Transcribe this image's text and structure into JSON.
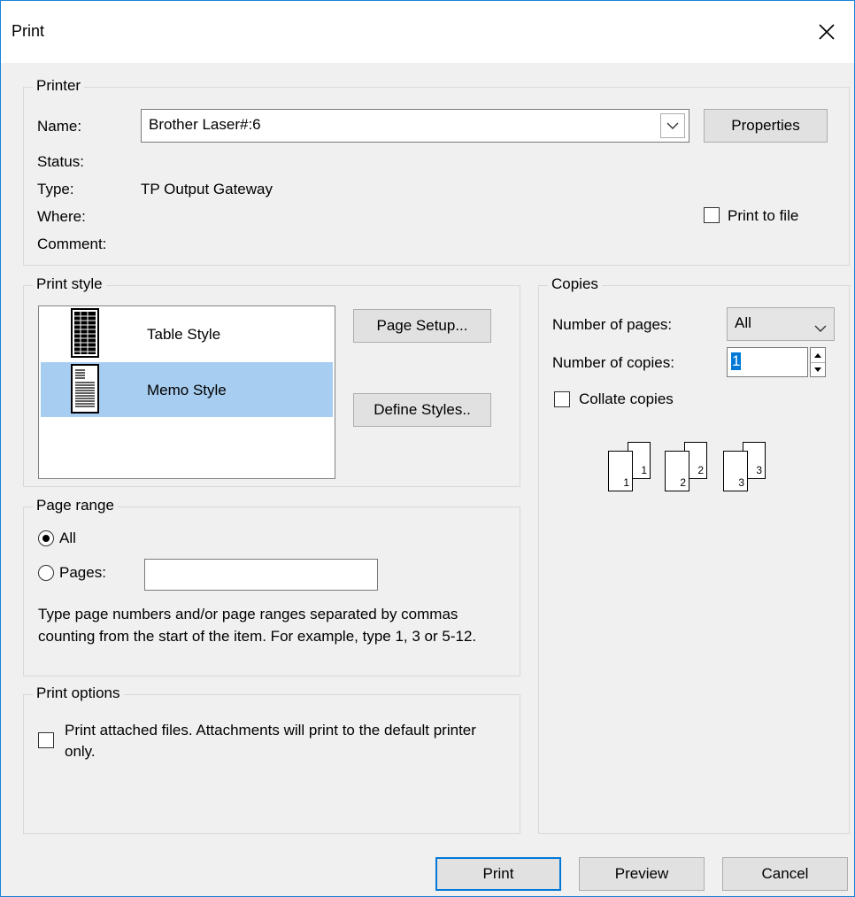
{
  "window": {
    "title": "Print"
  },
  "printer": {
    "group_label": "Printer",
    "name_label": "Name:",
    "name_value": "Brother Laser#:6",
    "properties_button": "Properties",
    "status_label": "Status:",
    "status_value": "",
    "type_label": "Type:",
    "type_value": "TP Output Gateway",
    "where_label": "Where:",
    "where_value": "",
    "comment_label": "Comment:",
    "comment_value": "",
    "print_to_file_label": "Print to file",
    "print_to_file_checked": false
  },
  "print_style": {
    "group_label": "Print style",
    "items": [
      {
        "label": "Table Style",
        "icon": "table-style-icon",
        "selected": false
      },
      {
        "label": "Memo Style",
        "icon": "memo-style-icon",
        "selected": true
      }
    ],
    "page_setup_button": "Page Setup...",
    "define_styles_button": "Define Styles.."
  },
  "copies": {
    "group_label": "Copies",
    "number_of_pages_label": "Number of pages:",
    "number_of_pages_value": "All",
    "number_of_copies_label": "Number of copies:",
    "number_of_copies_value": "1",
    "collate_label": "Collate copies",
    "collate_checked": false,
    "collate_pages": [
      {
        "back": "1",
        "front": "1"
      },
      {
        "back": "2",
        "front": "2"
      },
      {
        "back": "3",
        "front": "3"
      }
    ]
  },
  "page_range": {
    "group_label": "Page range",
    "all_label": "All",
    "all_selected": true,
    "pages_label": "Pages:",
    "pages_value": "",
    "description": "Type page numbers and/or page ranges separated by commas counting from the start of the item.  For example, type 1, 3 or 5-12."
  },
  "print_options": {
    "group_label": "Print options",
    "attachments_label": "Print attached files.  Attachments will print to the default printer only.",
    "attachments_checked": false
  },
  "footer": {
    "print_button": "Print",
    "preview_button": "Preview",
    "cancel_button": "Cancel"
  },
  "colors": {
    "accent": "#0078d7",
    "selection": "#a7cdf0",
    "dialog_bg": "#f0f0f0"
  }
}
